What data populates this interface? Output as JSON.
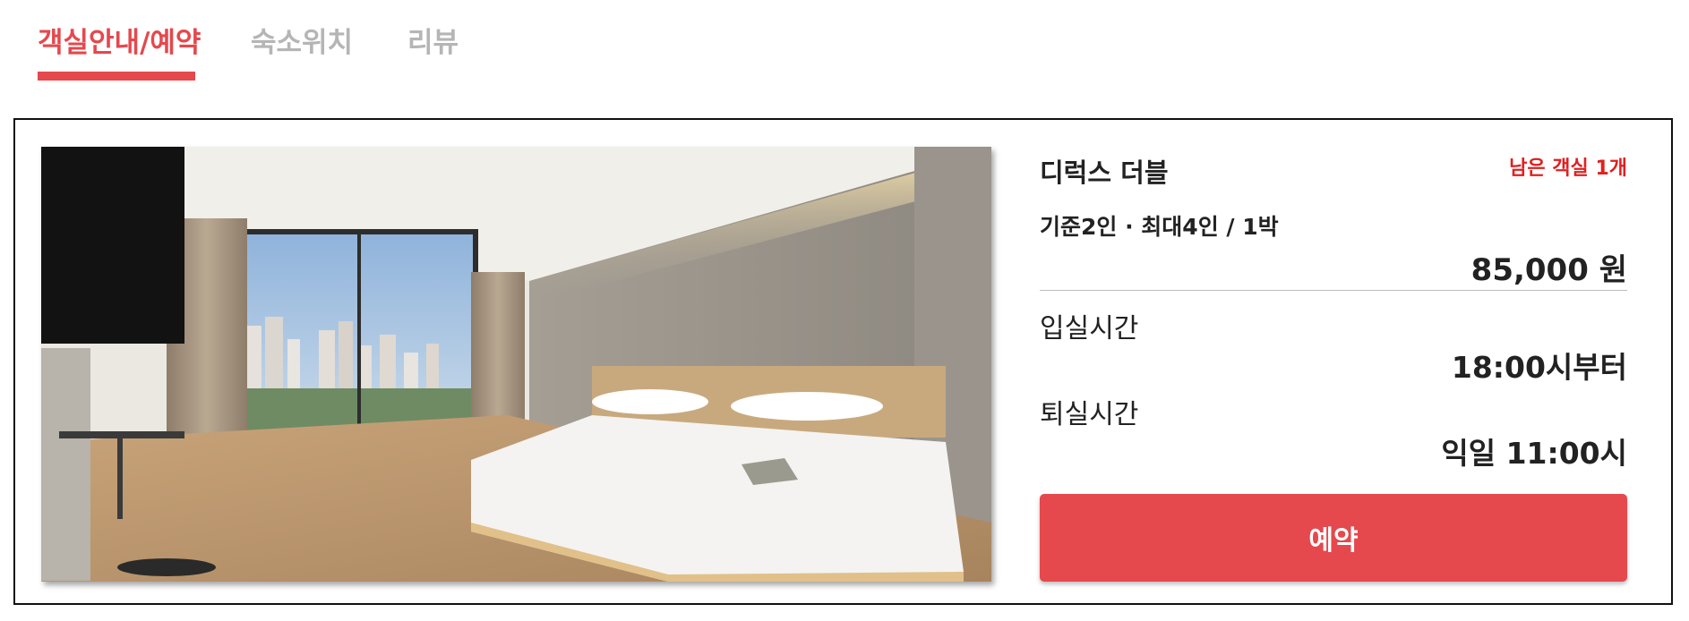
{
  "tabs": [
    {
      "label": "객실안내/예약",
      "active": true
    },
    {
      "label": "숙소위치",
      "active": false
    },
    {
      "label": "리뷰",
      "active": false
    }
  ],
  "room": {
    "name": "디럭스 더블",
    "rooms_left": "남은 객실 1개",
    "capacity": "기준2인 · 최대4인 / 1박",
    "price": "85,000 원",
    "checkin_label": "입실시간",
    "checkin_value": "18:00시부터",
    "checkout_label": "퇴실시간",
    "checkout_value": "익일 11:00시",
    "reserve_label": "예약",
    "photo_icon": "hotel-room-photo"
  },
  "colors": {
    "accent": "#e5484d",
    "alert": "#e02020",
    "inactive_tab": "#b5b5b5"
  }
}
